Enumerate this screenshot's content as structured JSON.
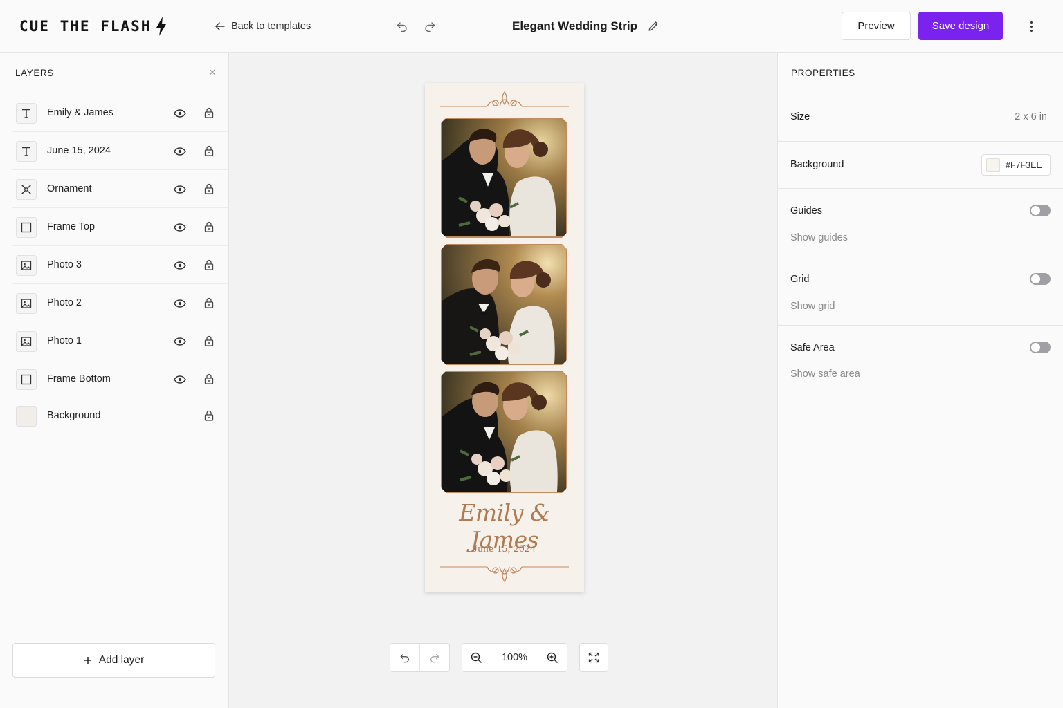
{
  "header": {
    "brand": "CUE THE FLASH",
    "back_label": "Back to templates",
    "title": "Elegant Wedding Strip",
    "preview_label": "Preview",
    "save_label": "Save design"
  },
  "layers_panel": {
    "title": "LAYERS",
    "items": [
      {
        "name": "Emily & James",
        "icon": "text-icon"
      },
      {
        "name": "June 15, 2024",
        "icon": "text-icon"
      },
      {
        "name": "Ornament",
        "icon": "ornament-icon"
      },
      {
        "name": "Frame Top",
        "icon": "square-icon"
      },
      {
        "name": "Photo 3",
        "icon": "image-icon"
      },
      {
        "name": "Photo 2",
        "icon": "image-icon"
      },
      {
        "name": "Photo 1",
        "icon": "image-icon"
      },
      {
        "name": "Frame Bottom",
        "icon": "square-icon"
      },
      {
        "name": "Background",
        "icon": "color-swatch-icon"
      }
    ],
    "add_label": "Add layer"
  },
  "canvas": {
    "strip_names": "Emily & James",
    "strip_date": "June 15, 2024",
    "zoom": "100%"
  },
  "properties": {
    "title": "PROPERTIES",
    "size_label": "Size",
    "size_value": "2 x 6 in",
    "background_label": "Background",
    "background_value": "#F7F3EE",
    "guides_label": "Guides",
    "guides_sub": "Show guides",
    "guides_on": false,
    "grid_label": "Grid",
    "grid_sub": "Show grid",
    "grid_on": false,
    "safe_label": "Safe Area",
    "safe_sub": "Show safe area",
    "safe_on": false
  },
  "colors": {
    "accent": "#7C22EE",
    "strip_bg": "#F6F1EA",
    "frame_gold": "#C28B5F"
  }
}
